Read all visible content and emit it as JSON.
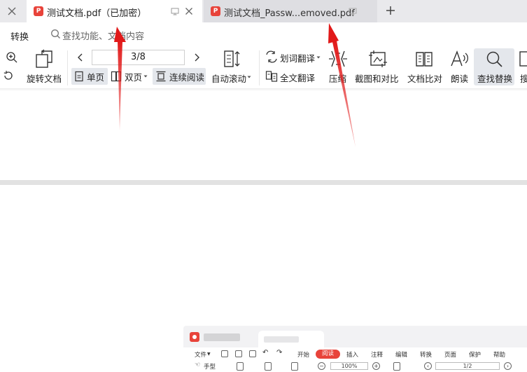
{
  "tabs": [
    {
      "title": "测试文档.pdf（已加密）",
      "active": true
    },
    {
      "title": "测试文档_Passw...emoved.pdf",
      "active": false
    }
  ],
  "menu": {
    "convert_label": "转换",
    "search_placeholder": "查找功能、文档内容"
  },
  "toolbar": {
    "rotate_label": "旋转文档",
    "page_indicator": "3/8",
    "single_page_label": "单页",
    "double_page_label": "双页",
    "continuous_label": "连续阅读",
    "auto_scroll_label": "自动滚动",
    "word_translate_label": "划词翻译",
    "full_translate_label": "全文翻译",
    "compress_label": "压缩",
    "screenshot_compare_label": "截图和对比",
    "doc_compare_label": "文档比对",
    "read_aloud_label": "朗读",
    "find_replace_label": "查找替换",
    "cut_label": "搜"
  },
  "embedded": {
    "menu_items": [
      "文件",
      "开始",
      "阅读",
      "插入",
      "注释",
      "编辑",
      "转换",
      "页面",
      "保护",
      "帮助"
    ],
    "hand_tool_label": "手型",
    "zoom_value": "100%",
    "page_value": "1/2"
  },
  "colors": {
    "accent_red": "#e8433a",
    "arrow_red": "#e11919",
    "selected_bg": "#e4e7ec",
    "tabbar_bg": "#e9e9ec"
  }
}
